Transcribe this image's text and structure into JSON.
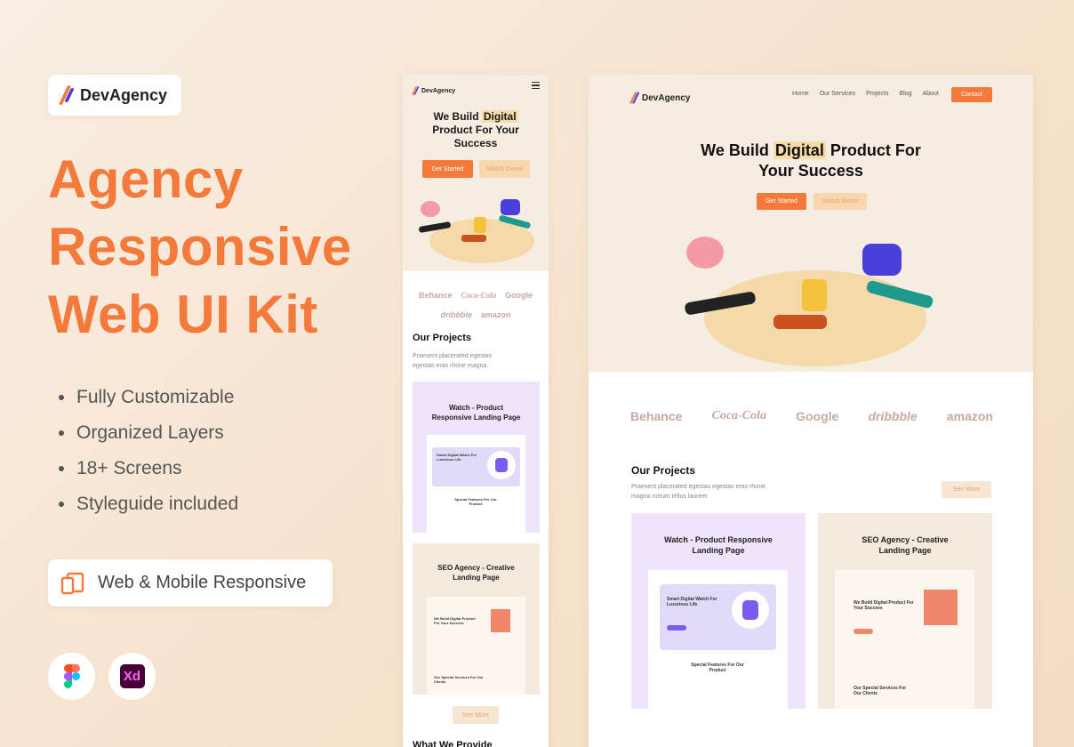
{
  "brand": {
    "name": "DevAgency"
  },
  "hero": {
    "title_lines": [
      "Agency",
      "Responsive",
      "Web UI Kit"
    ]
  },
  "features": [
    "Fully Customizable",
    "Organized Layers",
    "18+ Screens",
    "Styleguide included"
  ],
  "badge": {
    "label": "Web & Mobile Responsive",
    "icon": "devices-icon"
  },
  "tools": [
    {
      "name": "figma-icon"
    },
    {
      "name": "xd-icon",
      "label": "Xd"
    }
  ],
  "colors": {
    "accent": "#f47a3c",
    "light_accent": "#f7d7ae",
    "highlight": "#f5dba6",
    "hero_bg": "#f5ece2",
    "purple": "#7c5cf0"
  },
  "site": {
    "nav": [
      "Home",
      "Our Services",
      "Projects",
      "Blog",
      "About"
    ],
    "contact": "Contact",
    "headline_pre": "We Build ",
    "headline_hl": "Digital",
    "headline_post": " Product For Your Success",
    "mobile_headline_pre": "We Build ",
    "mobile_headline_hl": "Digital",
    "mobile_headline_post": "Product For Your Success",
    "get_started": "Get Started",
    "watch_demo": "Watch Demo",
    "partners": [
      "Behance",
      "Coca-Cola",
      "Google",
      "dribbble",
      "amazon"
    ],
    "projects_title": "Our Projects",
    "projects_desc": "Praesent placerated egestas egestas eras rhone magna rutrum tellus laoreet",
    "mobile_projects_desc": "Praesent placerated egestas egestas eras rhone magna",
    "see_more": "See More",
    "next_section": "What We Provide",
    "projects": [
      {
        "title": "Watch - Product Responsive Landing Page",
        "preview_headline": "Smart Digital Watch For Luxurious Life",
        "preview_section": "Special Features For Our Product"
      },
      {
        "title": "SEO Agency - Creative Landing Page",
        "preview_headline": "We Build Digital Product For Your Success",
        "preview_section": "Our Special Services For Our Clients"
      }
    ]
  }
}
